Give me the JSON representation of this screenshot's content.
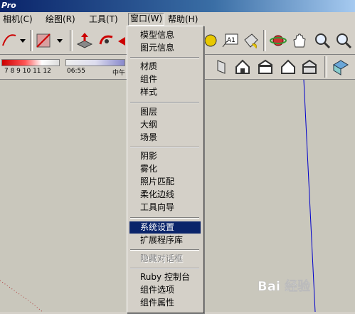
{
  "title": "Pro",
  "menubar": [
    {
      "label": "相机(C)"
    },
    {
      "label": "绘图(R)"
    },
    {
      "label": "工具(T)"
    },
    {
      "label": "窗口(W)"
    },
    {
      "label": "帮助(H)"
    }
  ],
  "toolbar": {
    "shadow_months": "7  8  9  10 11 12",
    "shadow_time": "06:55",
    "shadow_noon": "中午",
    "text_tool_label": "A1"
  },
  "window_menu": {
    "items": [
      {
        "label": "模型信息"
      },
      {
        "label": "图元信息"
      },
      {
        "label": "材质"
      },
      {
        "label": "组件"
      },
      {
        "label": "样式"
      },
      {
        "label": "图层"
      },
      {
        "label": "大纲"
      },
      {
        "label": "场景"
      },
      {
        "label": "阴影"
      },
      {
        "label": "雾化"
      },
      {
        "label": "照片匹配"
      },
      {
        "label": "柔化边线"
      },
      {
        "label": "工具向导"
      },
      {
        "label": "系统设置"
      },
      {
        "label": "扩展程序库"
      },
      {
        "label": "隐藏对话框"
      },
      {
        "label": "Ruby 控制台"
      },
      {
        "label": "组件选项"
      },
      {
        "label": "组件属性"
      }
    ]
  },
  "watermark": {
    "text": "Bai 经验"
  },
  "colors": {
    "selection": "#0a246a",
    "axis_blue": "#0000cc",
    "menu_bg": "#d4d0c8"
  }
}
